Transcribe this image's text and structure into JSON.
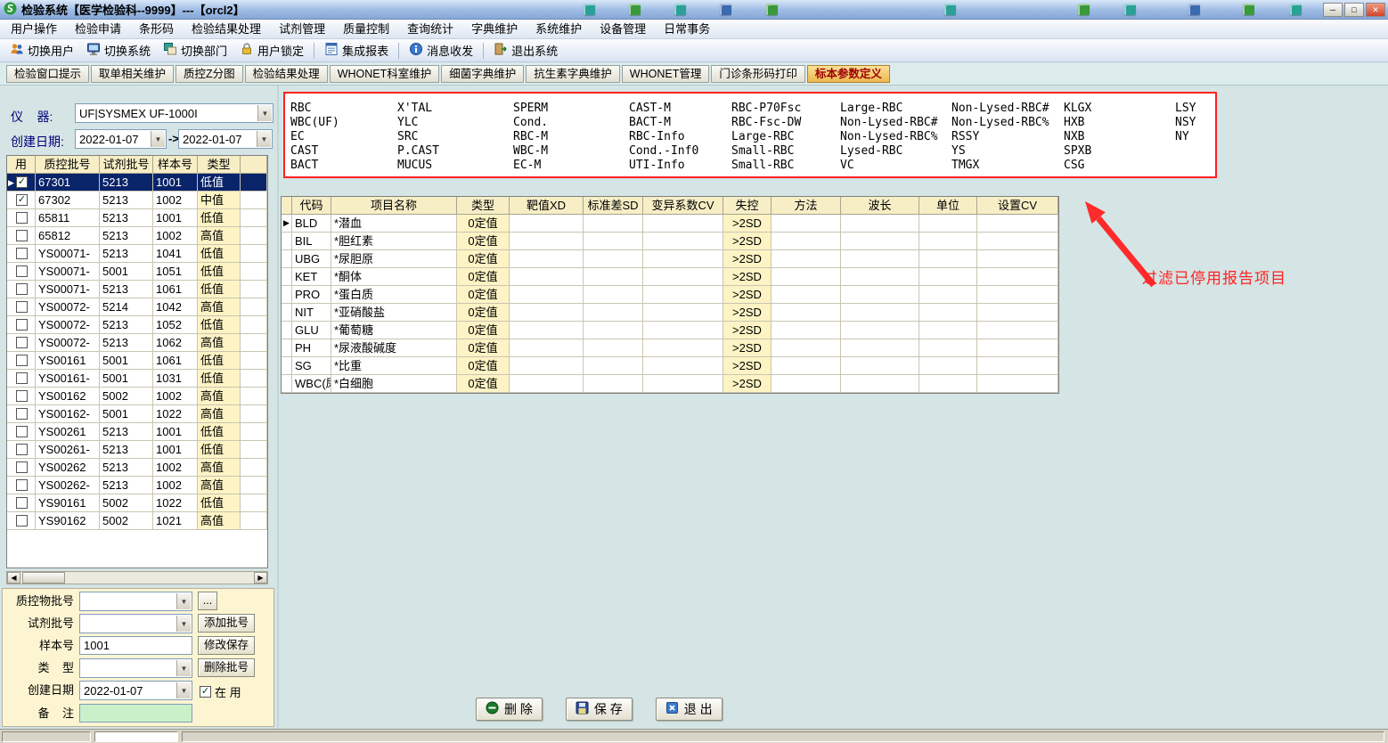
{
  "window": {
    "title": "检验系统【医学检验科--9999】---【orcl2】",
    "min_label": "─",
    "max_label": "□",
    "close_label": "✕"
  },
  "menu_items": [
    "用户操作",
    "检验申请",
    "条形码",
    "检验结果处理",
    "试剂管理",
    "质量控制",
    "查询统计",
    "字典维护",
    "系统维护",
    "设备管理",
    "日常事务"
  ],
  "toolbar_items": [
    {
      "label": "切换用户",
      "icon": "switch-user"
    },
    {
      "label": "切换系统",
      "icon": "switch-system"
    },
    {
      "label": "切换部门",
      "icon": "switch-dept"
    },
    {
      "label": "用户锁定",
      "icon": "lock-user",
      "sep_after": true
    },
    {
      "label": "集成报表",
      "icon": "report",
      "sep_after": true
    },
    {
      "label": "消息收发",
      "icon": "message",
      "sep_after": true
    },
    {
      "label": "退出系统",
      "icon": "exit"
    }
  ],
  "tabs": [
    "检验窗口提示",
    "取单相关维护",
    "质控Z分图",
    "检验结果处理",
    "WHONET科室维护",
    "细菌字典维护",
    "抗生素字典维护",
    "WHONET管理",
    "门诊条形码打印",
    "标本参数定义"
  ],
  "active_tab": "标本参数定义",
  "left_panel": {
    "instrument_label": "仪    器:",
    "instrument_value": "UF|SYSMEX UF-1000I",
    "date_label": "创建日期:",
    "date_from": "2022-01-07",
    "date_separator": "->",
    "date_to": "2022-01-07",
    "scrollbar_left": "◀",
    "scrollbar_right": "▶",
    "table": {
      "headers": [
        "用",
        "质控批号",
        "试剂批号",
        "样本号",
        "类型"
      ],
      "rows": [
        {
          "selected": true,
          "checked": true,
          "qc": "67301",
          "reagent": "5213",
          "sample": "1001",
          "type": "低值"
        },
        {
          "selected": false,
          "checked": true,
          "qc": "67302",
          "reagent": "5213",
          "sample": "1002",
          "type": "中值"
        },
        {
          "selected": false,
          "checked": false,
          "qc": "65811",
          "reagent": "5213",
          "sample": "1001",
          "type": "低值"
        },
        {
          "selected": false,
          "checked": false,
          "qc": "65812",
          "reagent": "5213",
          "sample": "1002",
          "type": "高值"
        },
        {
          "selected": false,
          "checked": false,
          "qc": "YS00071-",
          "reagent": "5213",
          "sample": "1041",
          "type": "低值"
        },
        {
          "selected": false,
          "checked": false,
          "qc": "YS00071-",
          "reagent": "5001",
          "sample": "1051",
          "type": "低值"
        },
        {
          "selected": false,
          "checked": false,
          "qc": "YS00071-",
          "reagent": "5213",
          "sample": "1061",
          "type": "低值"
        },
        {
          "selected": false,
          "checked": false,
          "qc": "YS00072-",
          "reagent": "5214",
          "sample": "1042",
          "type": "高值"
        },
        {
          "selected": false,
          "checked": false,
          "qc": "YS00072-",
          "reagent": "5213",
          "sample": "1052",
          "type": "低值"
        },
        {
          "selected": false,
          "checked": false,
          "qc": "YS00072-",
          "reagent": "5213",
          "sample": "1062",
          "type": "高值"
        },
        {
          "selected": false,
          "checked": false,
          "qc": "YS00161",
          "reagent": "5001",
          "sample": "1061",
          "type": "低值"
        },
        {
          "selected": false,
          "checked": false,
          "qc": "YS00161-",
          "reagent": "5001",
          "sample": "1031",
          "type": "低值"
        },
        {
          "selected": false,
          "checked": false,
          "qc": "YS00162",
          "reagent": "5002",
          "sample": "1002",
          "type": "高值"
        },
        {
          "selected": false,
          "checked": false,
          "qc": "YS00162-",
          "reagent": "5001",
          "sample": "1022",
          "type": "高值"
        },
        {
          "selected": false,
          "checked": false,
          "qc": "YS00261",
          "reagent": "5213",
          "sample": "1001",
          "type": "低值"
        },
        {
          "selected": false,
          "checked": false,
          "qc": "YS00261-",
          "reagent": "5213",
          "sample": "1001",
          "type": "低值"
        },
        {
          "selected": false,
          "checked": false,
          "qc": "YS00262",
          "reagent": "5213",
          "sample": "1002",
          "type": "高值"
        },
        {
          "selected": false,
          "checked": false,
          "qc": "YS00262-",
          "reagent": "5213",
          "sample": "1002",
          "type": "高值"
        },
        {
          "selected": false,
          "checked": false,
          "qc": "YS90161",
          "reagent": "5002",
          "sample": "1022",
          "type": "低值"
        },
        {
          "selected": false,
          "checked": false,
          "qc": "YS90162",
          "reagent": "5002",
          "sample": "1021",
          "type": "高值"
        }
      ]
    },
    "form": {
      "rows": [
        {
          "label": "质控物批号",
          "value": "",
          "button": "..."
        },
        {
          "label": "试剂批号",
          "value": "",
          "button": "添加批号"
        },
        {
          "label": "样本号",
          "value": "1001",
          "button": "修改保存"
        },
        {
          "label": "类    型",
          "value": "",
          "button": "删除批号"
        },
        {
          "label": "创建日期",
          "value": "2022-01-07"
        },
        {
          "label": "备    注",
          "value": ""
        }
      ],
      "in_use_label": "在  用",
      "in_use_checked": true
    }
  },
  "param_panel": {
    "columns": [
      [
        "RBC",
        "WBC(UF)",
        "EC",
        "CAST",
        "BACT"
      ],
      [
        "X'TAL",
        "YLC",
        "SRC",
        "P.CAST",
        "MUCUS"
      ],
      [
        "SPERM",
        "Cond.",
        "RBC-M",
        "WBC-M",
        "EC-M"
      ],
      [
        "CAST-M",
        "BACT-M",
        "RBC-Info",
        "Cond.-Inf0",
        "UTI-Info"
      ],
      [
        "RBC-P70Fsc",
        "RBC-Fsc-DW",
        "Large-RBC",
        "Small-RBC",
        "Small-RBC"
      ],
      [
        "Large-RBC",
        "Non-Lysed-RBC#",
        "Non-Lysed-RBC%",
        "Lysed-RBC",
        "VC"
      ],
      [
        "Non-Lysed-RBC#",
        "Non-Lysed-RBC%",
        "RSSY",
        "YS",
        "TMGX"
      ],
      [
        "KLGX",
        "HXB",
        "NXB",
        "SPXB",
        "CSG"
      ],
      [
        "LSY",
        "NSY",
        "NY"
      ]
    ]
  },
  "annotation": {
    "text": "过滤已停用报告项目",
    "color": "#ff2222"
  },
  "main_grid": {
    "headers": [
      "代码",
      "项目名称",
      "类型",
      "靶值XD",
      "标准差SD",
      "变异系数CV",
      "失控",
      "方法",
      "波长",
      "单位",
      "设置CV"
    ],
    "rows": [
      {
        "code": "BLD",
        "name": "*潜血",
        "type": "0定值",
        "target": "",
        "sd": "",
        "cv": "",
        "out_of_control": ">2SD",
        "method": "",
        "wavelength": "",
        "unit": "",
        "set_cv": ""
      },
      {
        "code": "BIL",
        "name": "*胆红素",
        "type": "0定值",
        "target": "",
        "sd": "",
        "cv": "",
        "out_of_control": ">2SD",
        "method": "",
        "wavelength": "",
        "unit": "",
        "set_cv": ""
      },
      {
        "code": "UBG",
        "name": "*尿胆原",
        "type": "0定值",
        "target": "",
        "sd": "",
        "cv": "",
        "out_of_control": ">2SD",
        "method": "",
        "wavelength": "",
        "unit": "",
        "set_cv": ""
      },
      {
        "code": "KET",
        "name": "*酮体",
        "type": "0定值",
        "target": "",
        "sd": "",
        "cv": "",
        "out_of_control": ">2SD",
        "method": "",
        "wavelength": "",
        "unit": "",
        "set_cv": ""
      },
      {
        "code": "PRO",
        "name": "*蛋白质",
        "type": "0定值",
        "target": "",
        "sd": "",
        "cv": "",
        "out_of_control": ">2SD",
        "method": "",
        "wavelength": "",
        "unit": "",
        "set_cv": ""
      },
      {
        "code": "NIT",
        "name": "*亚硝酸盐",
        "type": "0定值",
        "target": "",
        "sd": "",
        "cv": "",
        "out_of_control": ">2SD",
        "method": "",
        "wavelength": "",
        "unit": "",
        "set_cv": ""
      },
      {
        "code": "GLU",
        "name": "*葡萄糖",
        "type": "0定值",
        "target": "",
        "sd": "",
        "cv": "",
        "out_of_control": ">2SD",
        "method": "",
        "wavelength": "",
        "unit": "",
        "set_cv": ""
      },
      {
        "code": "PH",
        "name": "*尿液酸碱度",
        "type": "0定值",
        "target": "",
        "sd": "",
        "cv": "",
        "out_of_control": ">2SD",
        "method": "",
        "wavelength": "",
        "unit": "",
        "set_cv": ""
      },
      {
        "code": "SG",
        "name": "*比重",
        "type": "0定值",
        "target": "",
        "sd": "",
        "cv": "",
        "out_of_control": ">2SD",
        "method": "",
        "wavelength": "",
        "unit": "",
        "set_cv": ""
      },
      {
        "code": "WBC(尿",
        "name": "*白细胞",
        "type": "0定值",
        "target": "",
        "sd": "",
        "cv": "",
        "out_of_control": ">2SD",
        "method": "",
        "wavelength": "",
        "unit": "",
        "set_cv": ""
      }
    ]
  },
  "actions": [
    {
      "label": "删 除",
      "icon": "delete"
    },
    {
      "label": "保 存",
      "icon": "save"
    },
    {
      "label": "退 出",
      "icon": "exit-door"
    }
  ],
  "colors": {
    "selected_row": "#0a246a",
    "header_cream": "#f7eec6",
    "annotation_red": "#ff2222",
    "titlebar_blue": "#9dbbe4"
  }
}
